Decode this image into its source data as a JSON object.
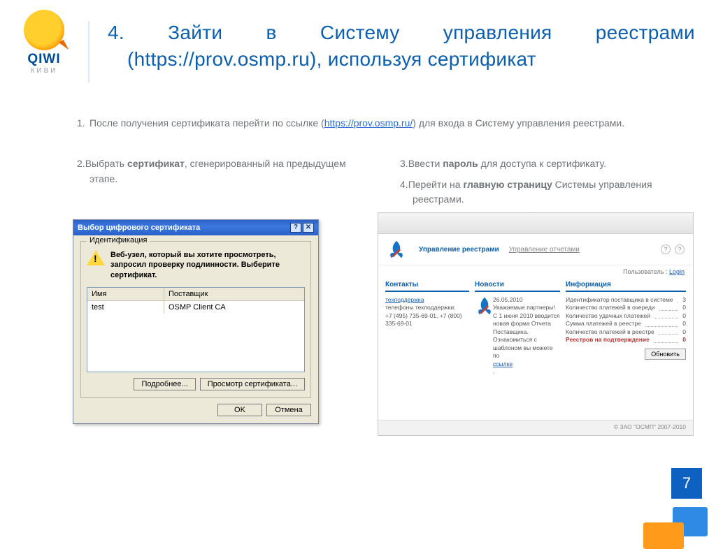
{
  "brand": {
    "name": "QIWI",
    "sub": "КИВИ"
  },
  "title_line1": "4. Зайти в Систему управления реестрами",
  "title_line2": "(https://prov.osmp.ru), используя сертификат",
  "step1_a": "После получения сертификата перейти по ссылке (",
  "step1_link": "https://prov.osmp.ru/",
  "step1_b": ") для входа в Систему управления реестрами.",
  "step2_a": "Выбрать ",
  "step2_bold": "сертификат",
  "step2_b": ", сгенерированный на предыдущем этапе.",
  "step3_a": "Ввести ",
  "step3_bold": "пароль",
  "step3_b": " для доступа к сертификату.",
  "step4_a": "Перейти на ",
  "step4_bold": "главную страницу",
  "step4_b": " Системы управления реестрами.",
  "nums": {
    "n1": "1.",
    "n2": "2.",
    "n3": "3.",
    "n4": "4."
  },
  "dialog": {
    "title": "Выбор цифрового сертификата",
    "help": "?",
    "close": "✕",
    "group_legend": "Идентификация",
    "message": "Веб-узел, который вы хотите просмотреть, запросил проверку подлинности. Выберите сертификат.",
    "col_name": "Имя",
    "col_issuer": "Поставщик",
    "row_name": "test",
    "row_issuer": "OSMP Client CA",
    "btn_more": "Подробнее...",
    "btn_view": "Просмотр сертификата...",
    "btn_ok": "OK",
    "btn_cancel": "Отмена"
  },
  "portal": {
    "tab1": "Управление реестрами",
    "tab2": "Управление отчетами",
    "user_label": "Пользователь : ",
    "user_link": "Login",
    "cards": {
      "contacts": {
        "title": "Контакты",
        "link": "техподдержка",
        "phone1": "телефоны техподдержки:",
        "phone2": "+7 (495) 735-69-01, +7 (800) 335-69-01"
      },
      "news": {
        "title": "Новости",
        "date": "26.05.2010",
        "text": "Уважаемые партнеры! С 1 июня 2010 вводится новая форма Отчета Поставщика. Ознакомиться с шаблоном вы можете по ",
        "link_word": "ссылке"
      },
      "info": {
        "title": "Информация",
        "rows": [
          {
            "k": "Идентификатор поставщика в системе",
            "v": "3"
          },
          {
            "k": "Количество платежей в очереди",
            "v": "0"
          },
          {
            "k": "Количество удачных платежей",
            "v": "0"
          },
          {
            "k": "Сумма платежей в реестре",
            "v": "0"
          },
          {
            "k": "Количество платежей в реестре",
            "v": "0"
          }
        ],
        "warn": "Реестров на подтверждение",
        "warn_v": "0",
        "refresh": "Обновить"
      }
    },
    "footer": "© ЗАО \"ОСМП\" 2007-2010"
  },
  "pagenum": "7"
}
